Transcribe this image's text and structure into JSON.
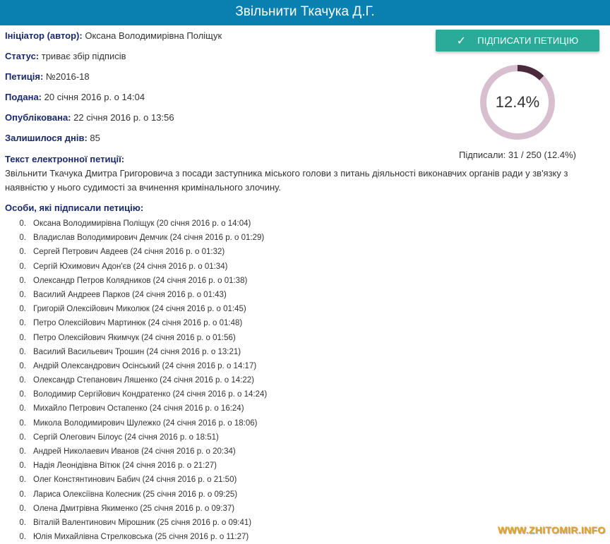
{
  "title": "Звільнити Ткачука Д.Г.",
  "meta": [
    {
      "label": "Ініціатор (автор):",
      "value": " Оксана Володимирівна Поліщук"
    },
    {
      "label": "Статус:",
      "value": " триває збір підписів"
    },
    {
      "label": "Петиція:",
      "value": " №2016-18"
    },
    {
      "label": "Подана:",
      "value": " 20 січня 2016 р. о 14:04"
    },
    {
      "label": "Опублікована:",
      "value": " 22 січня 2016 р. о 13:56"
    },
    {
      "label": "Залишилося днів:",
      "value": " 85"
    }
  ],
  "sign_button": {
    "label": "ПІДПИСАТИ ПЕТИЦІЮ",
    "icon": "checkmark-icon"
  },
  "progress": {
    "percent_text": "12.4%",
    "fraction": 0.124,
    "signed_text": "Підписали: 31 / 250 (12.4%)",
    "color_filled": "#4a2a3c",
    "color_remaining": "#d8bfd0"
  },
  "petition_text_label": "Текст електронної петиції:",
  "petition_text": "Звільнити Ткачука Дмитра Григоровича з посади заступника міського голови з питань діяльності виконавчих органів ради у зв'язку з наявністю у нього судимості за вчинення кримінального злочину.",
  "signers_label": "Особи, які підписали петицію:",
  "signers": [
    {
      "num": "0.",
      "text": "Оксана Володимирівна Поліщук (20 січня 2016 р. о 14:04)"
    },
    {
      "num": "0.",
      "text": "Владислав Володимирович Демчик (24 січня 2016 р. о 01:29)"
    },
    {
      "num": "0.",
      "text": "Сергей Петрович Авдеев (24 січня 2016 р. о 01:32)"
    },
    {
      "num": "0.",
      "text": "Сергій Юхимович Адон'єв (24 січня 2016 р. о 01:34)"
    },
    {
      "num": "0.",
      "text": "Олександр Петров Колядников (24 січня 2016 р. о 01:38)"
    },
    {
      "num": "0.",
      "text": "Василий Андреев Парков (24 січня 2016 р. о 01:43)"
    },
    {
      "num": "0.",
      "text": "Григорій Олексійович Миколюк (24 січня 2016 р. о 01:45)"
    },
    {
      "num": "0.",
      "text": "Петро Олексійович Мартинюк (24 січня 2016 р. о 01:48)"
    },
    {
      "num": "0.",
      "text": "Петро Олексійович Якимчук (24 січня 2016 р. о 01:56)"
    },
    {
      "num": "0.",
      "text": "Василий Васильевич Трошин (24 січня 2016 р. о 13:21)"
    },
    {
      "num": "0.",
      "text": "Андрій Олександрович Осінський (24 січня 2016 р. о 14:17)"
    },
    {
      "num": "0.",
      "text": "Олександр Степанович Ляшенко (24 січня 2016 р. о 14:22)"
    },
    {
      "num": "0.",
      "text": "Володимир Сергійович Кондратенко (24 січня 2016 р. о 14:24)"
    },
    {
      "num": "0.",
      "text": "Михайло Петрович Остапенко (24 січня 2016 р. о 16:24)"
    },
    {
      "num": "0.",
      "text": "Микола Володимирович Шулежко (24 січня 2016 р. о 18:06)"
    },
    {
      "num": "0.",
      "text": "Сергій Олегович Білоус (24 січня 2016 р. о 18:51)"
    },
    {
      "num": "0.",
      "text": "Андрей Николаевич Иванов (24 січня 2016 р. о 20:34)"
    },
    {
      "num": "0.",
      "text": "Надія Леонідівна Вітюк (24 січня 2016 р. о 21:27)"
    },
    {
      "num": "0.",
      "text": "Олег Констянтинович Бабич (24 січня 2016 р. о 21:50)"
    },
    {
      "num": "0.",
      "text": "Лариса Олексіївна Колесник (25 січня 2016 р. о 09:25)"
    },
    {
      "num": "0.",
      "text": "Олена Дмитрівна Якименко (25 січня 2016 р. о 09:37)"
    },
    {
      "num": "0.",
      "text": "Віталій Валентинович Мірошник (25 січня 2016 р. о 09:41)"
    },
    {
      "num": "0.",
      "text": "Юлія Михайлівна Стрелковська (25 січня 2016 р. о 11:27)"
    }
  ],
  "watermark": "WWW.ZHITOMIR.INFO"
}
